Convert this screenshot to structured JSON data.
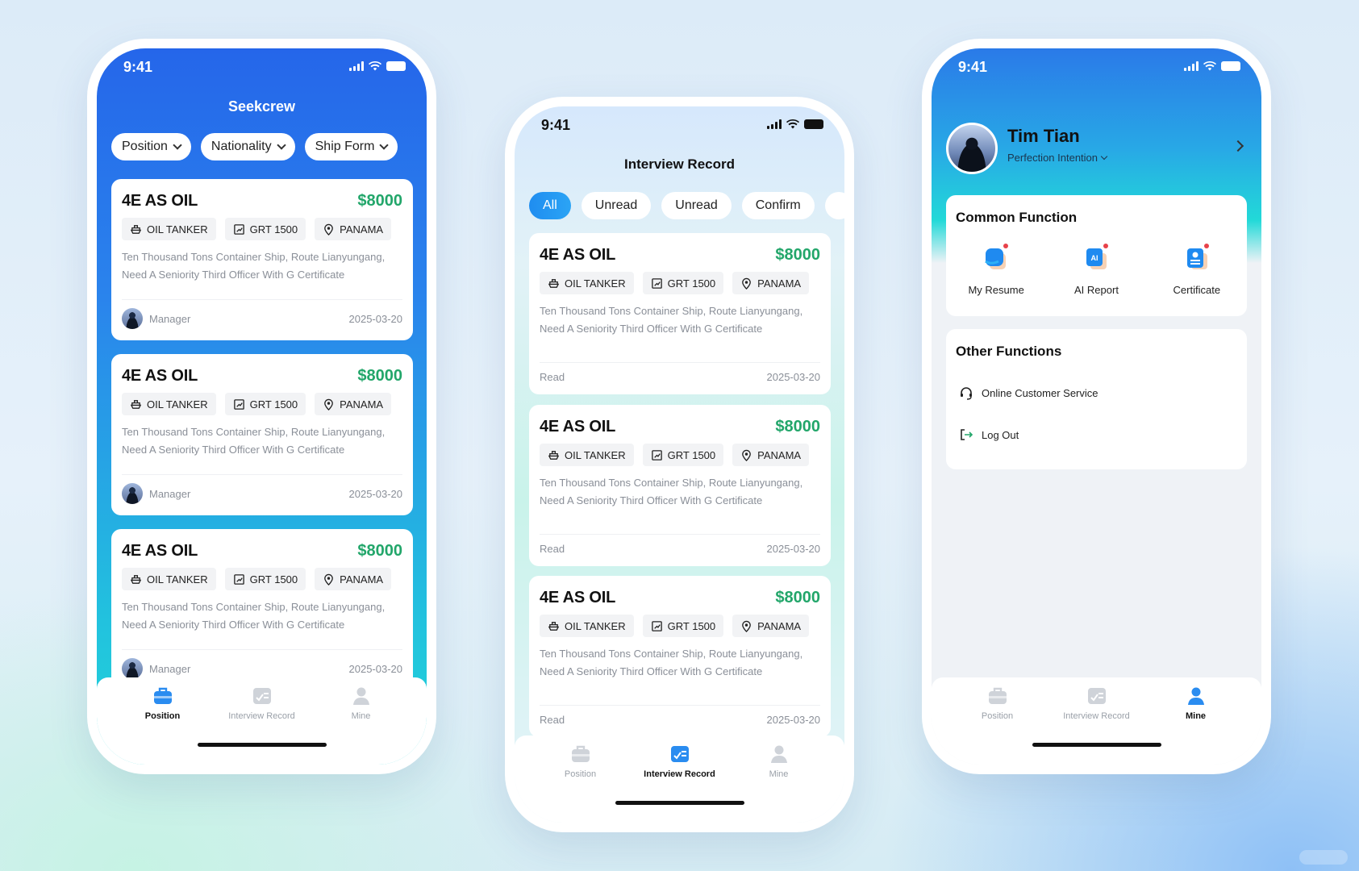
{
  "status": {
    "time": "9:41"
  },
  "position_screen": {
    "title": "Seekcrew",
    "filters": [
      "Position",
      "Nationality",
      "Ship Form"
    ],
    "cards": [
      {
        "name": "4E AS OIL",
        "salary": "$8000",
        "tags": [
          "OIL TANKER",
          "GRT 1500",
          "PANAMA"
        ],
        "desc1": "Ten Thousand Tons Container Ship, Route Lianyungang,",
        "desc2": "Need A Seniority Third Officer With G Certificate",
        "poster": "Manager",
        "date": "2025-03-20"
      },
      {
        "name": "4E AS OIL",
        "salary": "$8000",
        "tags": [
          "OIL TANKER",
          "GRT 1500",
          "PANAMA"
        ],
        "desc1": "Ten Thousand Tons Container Ship, Route Lianyungang,",
        "desc2": "Need A Seniority Third Officer With G Certificate",
        "poster": "Manager",
        "date": "2025-03-20"
      },
      {
        "name": "4E AS OIL",
        "salary": "$8000",
        "tags": [
          "OIL TANKER",
          "GRT 1500",
          "PANAMA"
        ],
        "desc1": "Ten Thousand Tons Container Ship, Route Lianyungang,",
        "desc2": "Need A Seniority Third Officer With G Certificate",
        "poster": "Manager",
        "date": "2025-03-20"
      }
    ]
  },
  "interview_screen": {
    "title": "Interview Record",
    "segments": [
      "All",
      "Unread",
      "Unread",
      "Confirm"
    ],
    "cards": [
      {
        "name": "4E AS OIL",
        "salary": "$8000",
        "tags": [
          "OIL TANKER",
          "GRT 1500",
          "PANAMA"
        ],
        "desc1": "Ten Thousand Tons Container Ship, Route Lianyungang,",
        "desc2": "Need A Seniority Third Officer With G Certificate",
        "status": "Read",
        "date": "2025-03-20"
      },
      {
        "name": "4E AS OIL",
        "salary": "$8000",
        "tags": [
          "OIL TANKER",
          "GRT 1500",
          "PANAMA"
        ],
        "desc1": "Ten Thousand Tons Container Ship, Route Lianyungang,",
        "desc2": "Need A Seniority Third Officer With G Certificate",
        "status": "Read",
        "date": "2025-03-20"
      },
      {
        "name": "4E AS OIL",
        "salary": "$8000",
        "tags": [
          "OIL TANKER",
          "GRT 1500",
          "PANAMA"
        ],
        "desc1": "Ten Thousand Tons Container Ship, Route Lianyungang,",
        "desc2": "Need A Seniority Third Officer With G Certificate",
        "status": "Read",
        "date": "2025-03-20"
      }
    ]
  },
  "mine_screen": {
    "user_name": "Tim Tian",
    "intention": "Perfection Intention",
    "common_title": "Common Function",
    "common": [
      "My Resume",
      "AI Report",
      "Certificate"
    ],
    "other_title": "Other Functions",
    "other": [
      "Online Customer Service",
      "Log Out"
    ]
  },
  "tabbar": {
    "position": "Position",
    "interview": "Interview Record",
    "mine": "Mine"
  },
  "colors": {
    "primary_blue": "#2468e8",
    "cyan": "#22d3d6",
    "salary_green": "#22a66a",
    "badge_red": "#e8424a"
  },
  "icons": [
    "ship-icon",
    "grt-icon",
    "location-pin-icon",
    "briefcase-icon",
    "record-icon",
    "person-icon",
    "resume-icon",
    "ai-report-icon",
    "certificate-icon",
    "headset-icon",
    "logout-icon"
  ]
}
